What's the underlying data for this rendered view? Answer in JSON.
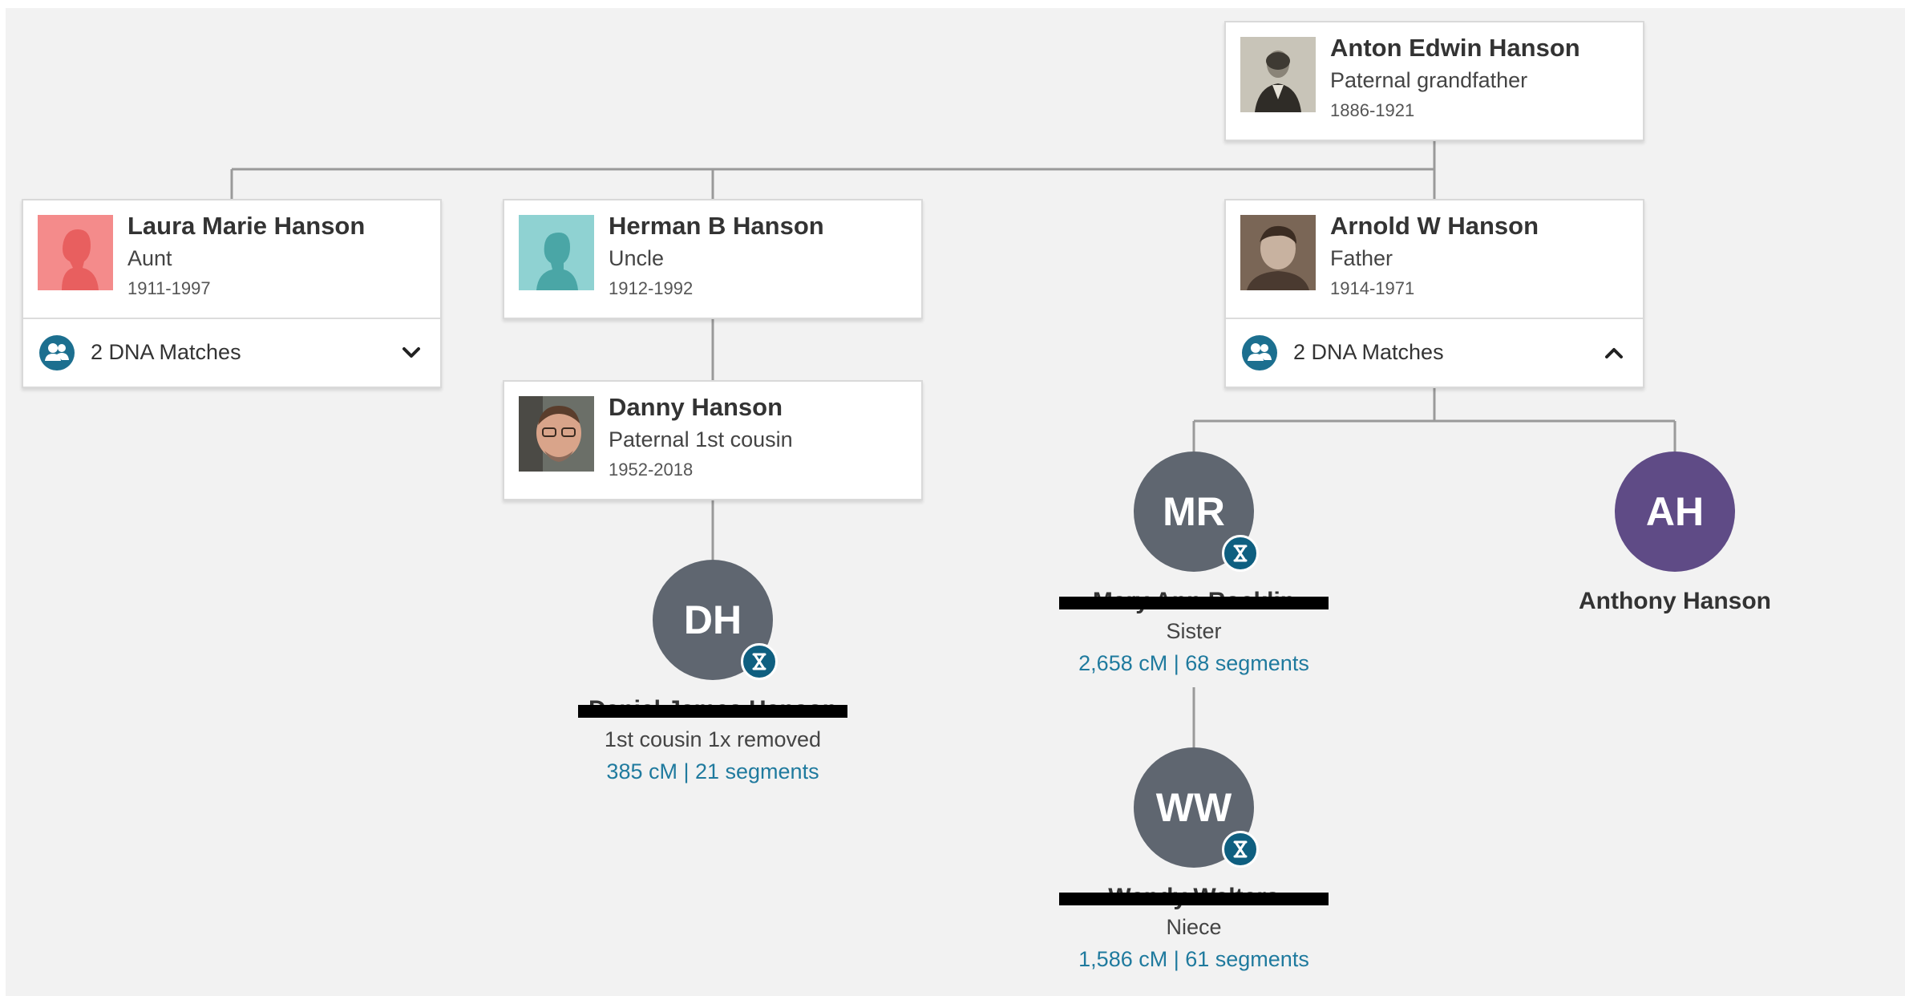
{
  "colors": {
    "canvas_bg": "#f2f2f2",
    "connector": "#9a9a9a",
    "link": "#1f7a9e",
    "dna_icon": "#1c6f8f",
    "avatar_gray": "#5f6670",
    "avatar_purple": "#5f4b86",
    "female_silhouette_bg": "#f48b8b",
    "male_silhouette_bg": "#8fd2d2"
  },
  "tree": {
    "grandfather": {
      "name": "Anton Edwin Hanson",
      "relationship": "Paternal grandfather",
      "dates": "1886-1921",
      "photo": "vintage-portrait-photo"
    },
    "aunt": {
      "name": "Laura Marie Hanson",
      "relationship": "Aunt",
      "dates": "1911-1997",
      "photo": "female-silhouette-icon",
      "dna_matches": "2 DNA Matches",
      "expanded": false
    },
    "uncle": {
      "name": "Herman B Hanson",
      "relationship": "Uncle",
      "dates": "1912-1992",
      "photo": "male-silhouette-icon"
    },
    "father": {
      "name": "Arnold W Hanson",
      "relationship": "Father",
      "dates": "1914-1971",
      "photo": "vintage-portrait-photo",
      "dna_matches": "2 DNA Matches",
      "expanded": true
    },
    "cousin": {
      "name": "Danny Hanson",
      "relationship": "Paternal 1st cousin",
      "dates": "1952-2018",
      "photo": "portrait-photo"
    }
  },
  "matches": {
    "dh": {
      "initials": "DH",
      "name": "Daniel James Hanson",
      "redacted": true,
      "relationship": "1st cousin 1x removed",
      "shared_dna": "385 cM | 21 segments"
    },
    "mr": {
      "initials": "MR",
      "name": "Mary Ann Rocklin",
      "redacted": true,
      "relationship": "Sister",
      "shared_dna": "2,658 cM | 68 segments"
    },
    "ah": {
      "initials": "AH",
      "name": "Anthony Hanson",
      "redacted": false
    },
    "ww": {
      "initials": "WW",
      "name": "Wendy Walters",
      "redacted": true,
      "relationship": "Niece",
      "shared_dna": "1,586 cM | 61 segments"
    }
  }
}
